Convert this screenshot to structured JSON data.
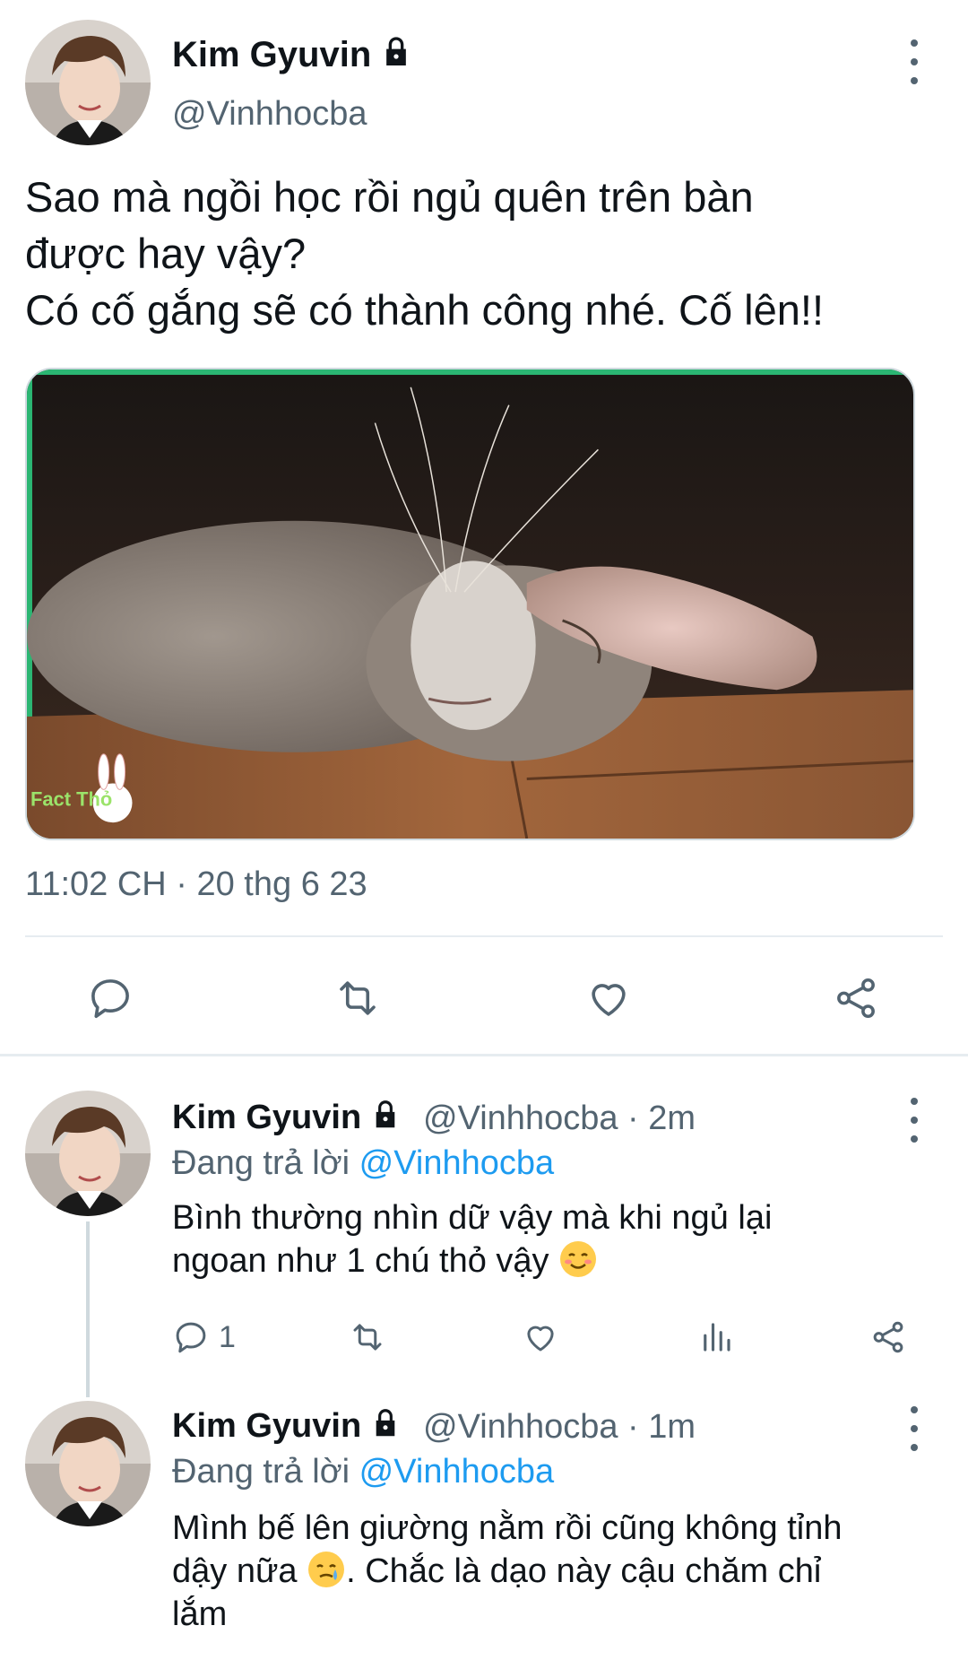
{
  "main_tweet": {
    "author_name": "Kim Gyuvin",
    "author_handle": "@Vinhhocba",
    "text": "Sao mà ngồi học rồi ngủ quên trên bàn\nđược hay vậy?\nCó cố gắng sẽ có thành công nhé. Cố lên!!",
    "timestamp": "11:02 CH · 20 thg 6 23",
    "media_watermark": "Fact Thỏ"
  },
  "replies": [
    {
      "author_name": "Kim Gyuvin",
      "handle_time": "@Vinhhocba · 2m",
      "replying_label": "Đang trả lời",
      "replying_to": "@Vinhhocba",
      "text_before_emoji": "Bình thường nhìn dữ vậy mà khi ngủ lại\nngoan như 1 chú thỏ vậy ",
      "text_after_emoji": "",
      "emoji": "smiling-face-icon",
      "reply_count": "1"
    },
    {
      "author_name": "Kim Gyuvin",
      "handle_time": "@Vinhhocba · 1m",
      "replying_label": "Đang trả lời",
      "replying_to": "@Vinhhocba",
      "text_line1": "Mình bế lên giường nằm rồi cũng không tỉnh",
      "text_line2_before": "dậy nữa ",
      "text_line2_after": ". Chắc là dạo này cậu chăm chỉ",
      "text_line3": "lắm",
      "emoji": "crying-smile-icon"
    }
  ],
  "colors": {
    "text": "#0f1419",
    "secondary": "#536471",
    "accent": "#1d9bf0",
    "divider": "#e6ecf0"
  }
}
